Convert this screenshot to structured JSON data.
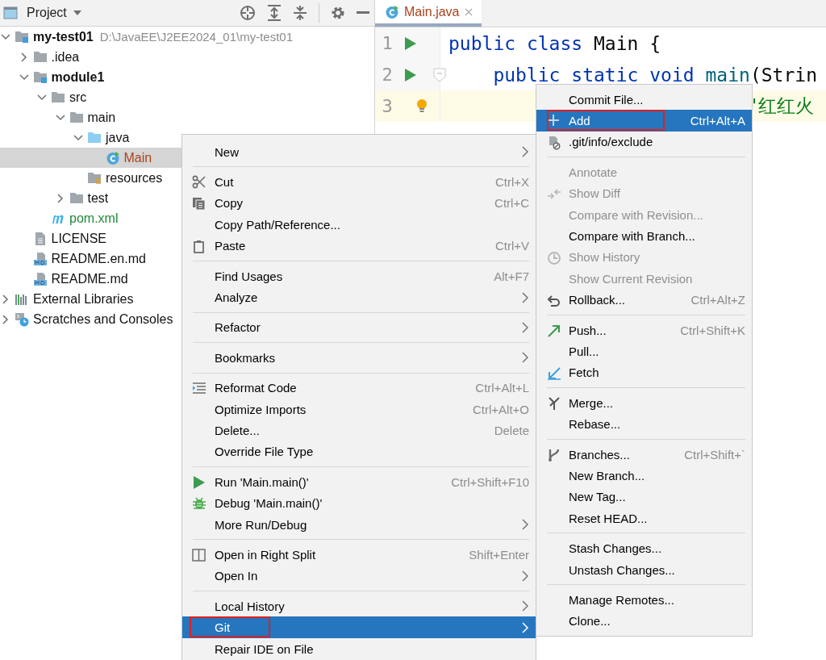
{
  "project_panel": {
    "title": "Project",
    "tree": [
      {
        "label": "my-test01",
        "bold": true,
        "hint": "D:\\JavaEE\\J2EE2024_01\\my-test01",
        "kind": "module",
        "expanded": true,
        "selected": false,
        "children": [
          {
            "label": ".idea",
            "kind": "folder",
            "expanded": false,
            "selected": false
          },
          {
            "label": "module1",
            "bold": true,
            "kind": "module",
            "expanded": true,
            "selected": false,
            "children": [
              {
                "label": "src",
                "kind": "folder",
                "expanded": true,
                "selected": false,
                "children": [
                  {
                    "label": "main",
                    "kind": "folder",
                    "expanded": true,
                    "selected": false,
                    "children": [
                      {
                        "label": "java",
                        "kind": "source",
                        "expanded": true,
                        "selected": false,
                        "children": [
                          {
                            "label": "Main",
                            "kind": "class",
                            "color": "#a8441c",
                            "selected": true
                          }
                        ]
                      },
                      {
                        "label": "resources",
                        "kind": "resources",
                        "selected": false
                      }
                    ]
                  },
                  {
                    "label": "test",
                    "kind": "folder",
                    "expanded": false,
                    "selected": false
                  }
                ]
              },
              {
                "label": "pom.xml",
                "kind": "maven",
                "color": "#1f8a3a",
                "selected": false
              }
            ]
          },
          {
            "label": "LICENSE",
            "kind": "file",
            "selected": false
          },
          {
            "label": "README.en.md",
            "kind": "markdown",
            "selected": false
          },
          {
            "label": "README.md",
            "kind": "markdown",
            "selected": false
          }
        ]
      },
      {
        "label": "External Libraries",
        "kind": "libraries",
        "expanded": false,
        "selected": false
      },
      {
        "label": "Scratches and Consoles",
        "kind": "scratches",
        "expanded": false,
        "selected": false
      }
    ]
  },
  "editor": {
    "tabs": [
      {
        "label": "Main.java",
        "color": "#a8441c",
        "selected": true
      }
    ],
    "lines": [
      {
        "number": "1",
        "run": true,
        "current": false,
        "tokens": [
          {
            "t": "public class ",
            "kind": "keyword"
          },
          {
            "t": "Main {",
            "kind": "plain"
          }
        ]
      },
      {
        "number": "2",
        "run": true,
        "current": false,
        "tokens": [
          {
            "t": "    public static void ",
            "kind": "keyword"
          },
          {
            "t": "main",
            "kind": "method"
          },
          {
            "t": "(Strin",
            "kind": "plain"
          }
        ]
      },
      {
        "number": "3",
        "run": false,
        "current": true,
        "tokens": [
          {
            "t": "\"红红火",
            "kind": "string"
          }
        ]
      }
    ]
  },
  "context_menu": {
    "items": [
      {
        "label": "New",
        "submenu": true,
        "selected": false
      },
      {
        "kind": "separator"
      },
      {
        "label": "Cut",
        "shortcut": "Ctrl+X",
        "selected": false
      },
      {
        "label": "Copy",
        "shortcut": "Ctrl+C",
        "selected": false
      },
      {
        "label": "Copy Path/Reference...",
        "selected": false
      },
      {
        "label": "Paste",
        "shortcut": "Ctrl+V",
        "selected": false
      },
      {
        "kind": "separator"
      },
      {
        "label": "Find Usages",
        "shortcut": "Alt+F7",
        "selected": false
      },
      {
        "label": "Analyze",
        "submenu": true,
        "selected": false
      },
      {
        "kind": "separator"
      },
      {
        "label": "Refactor",
        "submenu": true,
        "selected": false
      },
      {
        "kind": "separator"
      },
      {
        "label": "Bookmarks",
        "submenu": true,
        "selected": false
      },
      {
        "kind": "separator"
      },
      {
        "label": "Reformat Code",
        "shortcut": "Ctrl+Alt+L",
        "selected": false
      },
      {
        "label": "Optimize Imports",
        "shortcut": "Ctrl+Alt+O",
        "selected": false
      },
      {
        "label": "Delete...",
        "shortcut": "Delete",
        "selected": false
      },
      {
        "label": "Override File Type",
        "selected": false
      },
      {
        "kind": "separator"
      },
      {
        "label": "Run 'Main.main()'",
        "shortcut": "Ctrl+Shift+F10",
        "selected": false
      },
      {
        "label": "Debug 'Main.main()'",
        "selected": false
      },
      {
        "label": "More Run/Debug",
        "submenu": true,
        "selected": false
      },
      {
        "kind": "separator"
      },
      {
        "label": "Open in Right Split",
        "shortcut": "Shift+Enter",
        "selected": false
      },
      {
        "label": "Open In",
        "submenu": true,
        "selected": false
      },
      {
        "kind": "separator"
      },
      {
        "label": "Local History",
        "submenu": true,
        "selected": false
      },
      {
        "label": "Git",
        "submenu": true,
        "selected": true
      },
      {
        "label": "Repair IDE on File",
        "selected": false
      }
    ]
  },
  "git_menu": {
    "items": [
      {
        "label": "Commit File...",
        "disabled": false,
        "selected": false
      },
      {
        "label": "Add",
        "shortcut": "Ctrl+Alt+A",
        "disabled": false,
        "selected": true
      },
      {
        "label": ".git/info/exclude",
        "disabled": false,
        "selected": false
      },
      {
        "kind": "separator"
      },
      {
        "label": "Annotate",
        "disabled": true,
        "selected": false
      },
      {
        "label": "Show Diff",
        "disabled": true,
        "selected": false
      },
      {
        "label": "Compare with Revision...",
        "disabled": true,
        "selected": false
      },
      {
        "label": "Compare with Branch...",
        "disabled": false,
        "selected": false
      },
      {
        "label": "Show History",
        "disabled": true,
        "selected": false
      },
      {
        "label": "Show Current Revision",
        "disabled": true,
        "selected": false
      },
      {
        "label": "Rollback...",
        "shortcut": "Ctrl+Alt+Z",
        "disabled": false,
        "selected": false
      },
      {
        "kind": "separator"
      },
      {
        "label": "Push...",
        "shortcut": "Ctrl+Shift+K",
        "disabled": false,
        "selected": false
      },
      {
        "label": "Pull...",
        "disabled": false,
        "selected": false
      },
      {
        "label": "Fetch",
        "disabled": false,
        "selected": false
      },
      {
        "kind": "separator"
      },
      {
        "label": "Merge...",
        "disabled": false,
        "selected": false
      },
      {
        "label": "Rebase...",
        "disabled": false,
        "selected": false
      },
      {
        "kind": "separator"
      },
      {
        "label": "Branches...",
        "shortcut": "Ctrl+Shift+`",
        "disabled": false,
        "selected": false
      },
      {
        "label": "New Branch...",
        "disabled": false,
        "selected": false
      },
      {
        "label": "New Tag...",
        "disabled": false,
        "selected": false
      },
      {
        "label": "Reset HEAD...",
        "disabled": false,
        "selected": false
      },
      {
        "kind": "separator"
      },
      {
        "label": "Stash Changes...",
        "disabled": false,
        "selected": false
      },
      {
        "label": "Unstash Changes...",
        "disabled": false,
        "selected": false
      },
      {
        "kind": "separator"
      },
      {
        "label": "Manage Remotes...",
        "disabled": false,
        "selected": false
      },
      {
        "label": "Clone...",
        "disabled": false,
        "selected": false
      }
    ]
  }
}
